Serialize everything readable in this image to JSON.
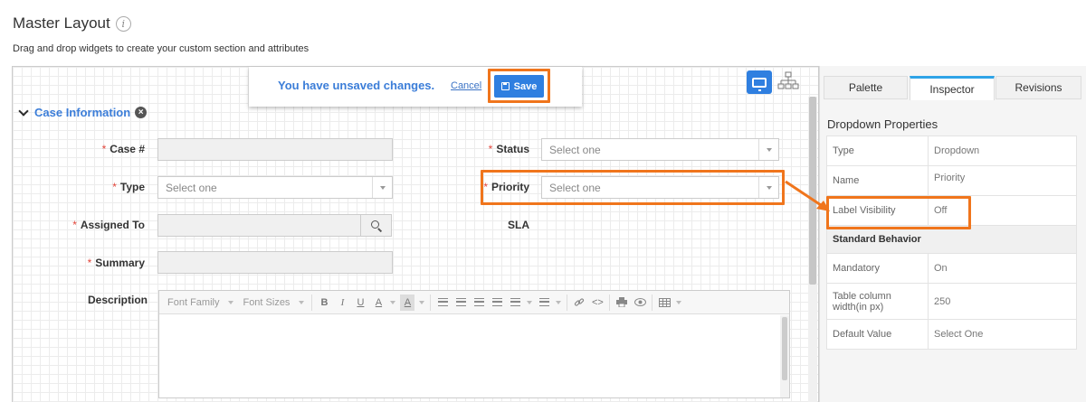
{
  "page": {
    "title": "Master Layout",
    "subtitle": "Drag and drop widgets to create your custom section and attributes"
  },
  "toolbar": {
    "unsaved_message": "You have unsaved changes.",
    "cancel_label": "Cancel",
    "save_label": "Save"
  },
  "section": {
    "title": "Case Information"
  },
  "fields": {
    "case_number": {
      "label": "Case #",
      "required": true
    },
    "status": {
      "label": "Status",
      "required": true,
      "placeholder": "Select one"
    },
    "type": {
      "label": "Type",
      "required": true,
      "placeholder": "Select one"
    },
    "priority": {
      "label": "Priority",
      "required": true,
      "placeholder": "Select one"
    },
    "assigned_to": {
      "label": "Assigned To",
      "required": true
    },
    "sla": {
      "label": "SLA",
      "required": false
    },
    "summary": {
      "label": "Summary",
      "required": true
    },
    "description": {
      "label": "Description",
      "required": false
    }
  },
  "editor": {
    "font_family": "Font Family",
    "font_sizes": "Font Sizes",
    "bold": "B",
    "italic": "I",
    "underline": "U",
    "font_color": "A",
    "bg_color": "A",
    "source": "<>"
  },
  "panel": {
    "tabs": [
      {
        "label": "Palette",
        "active": false
      },
      {
        "label": "Inspector",
        "active": true
      },
      {
        "label": "Revisions",
        "active": false
      }
    ],
    "title": "Dropdown Properties",
    "rows": [
      {
        "key": "Type",
        "value": "Dropdown"
      },
      {
        "key": "Name",
        "value": "Priority"
      },
      {
        "key": "Label Visibility",
        "value": "Off"
      }
    ],
    "section_label": "Standard Behavior",
    "behavior_rows": [
      {
        "key": "Mandatory",
        "value": "On"
      },
      {
        "key": "Table column width(in px)",
        "value": "250"
      },
      {
        "key": "Default Value",
        "value": "Select One"
      }
    ]
  },
  "colors": {
    "accent_blue": "#2f7fe0",
    "highlight_orange": "#f0751c",
    "required_red": "#e2453a",
    "active_tab_border": "#2fa4e7"
  }
}
